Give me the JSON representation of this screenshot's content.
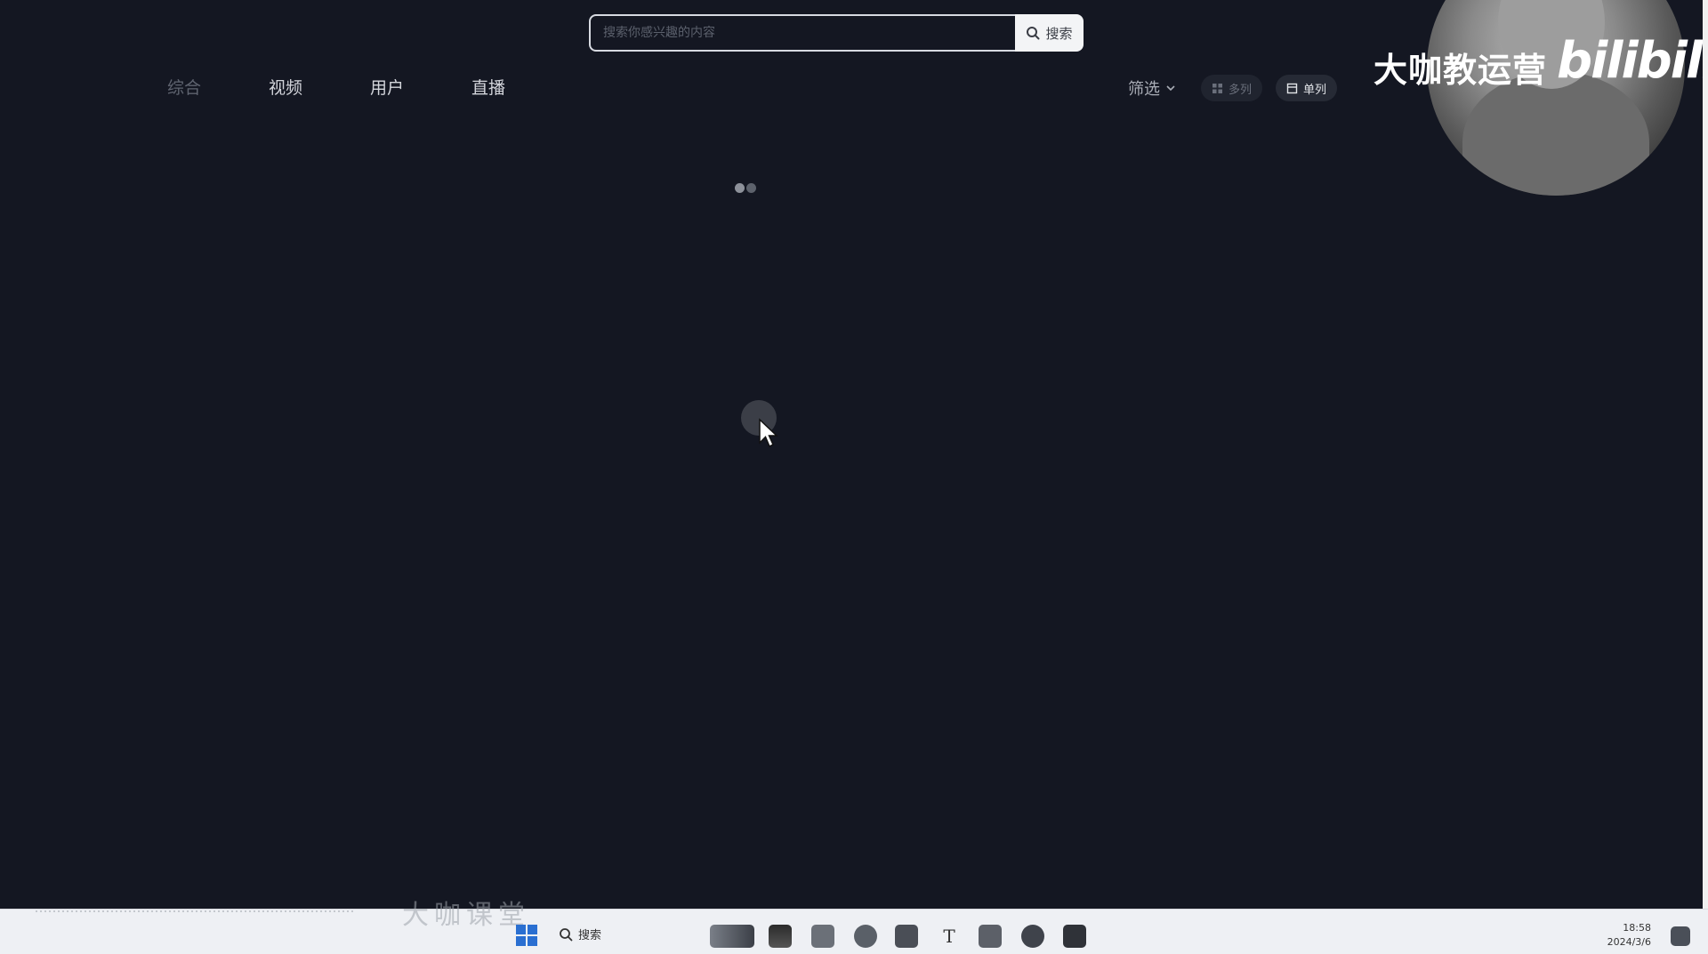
{
  "search": {
    "placeholder": "搜索你感兴趣的内容",
    "button_label": "搜索"
  },
  "tabs": [
    {
      "label": "综合",
      "active": true
    },
    {
      "label": "视频",
      "active": false
    },
    {
      "label": "用户",
      "active": false
    },
    {
      "label": "直播",
      "active": false
    }
  ],
  "filter": {
    "label": "筛选",
    "icon": "chevron-down-icon"
  },
  "view_toggle": {
    "multi_label": "多列",
    "single_label": "单列",
    "selected": "single"
  },
  "loading": {
    "icon": "loading-dots-icon"
  },
  "overlay": {
    "watermark_text": "大咖教运营",
    "logo_text": "bilibili"
  },
  "taskbar": {
    "search_label": "搜索",
    "brand_watermark": "大咖课堂",
    "time": "18:58",
    "date": "2024/3/6",
    "icons": [
      "start-icon",
      "search-icon",
      "widgets-icon",
      "task-view-icon",
      "file-explorer-icon",
      "edge-icon",
      "store-icon",
      "typora-icon",
      "notepad-icon",
      "edge-dev-icon",
      "app-icon",
      "notification-icon"
    ]
  },
  "colors": {
    "background": "#141722",
    "taskbar": "#eef0f4",
    "accent_blue": "#2a6fd1"
  }
}
